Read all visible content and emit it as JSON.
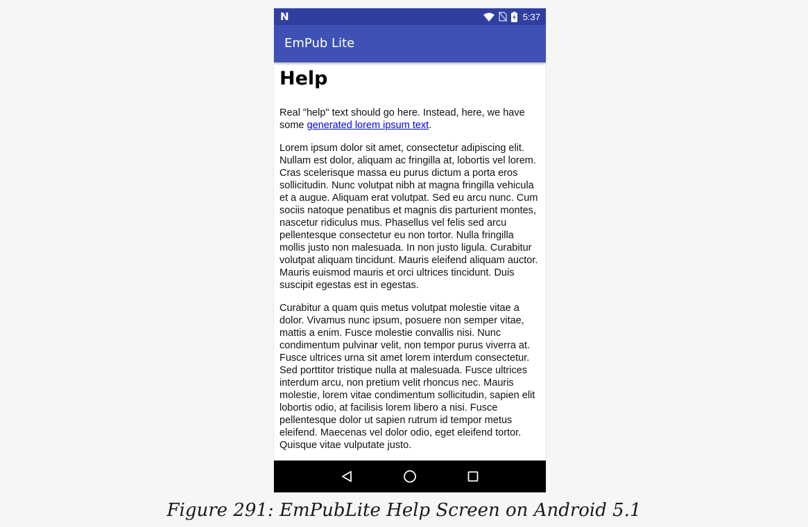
{
  "status_bar": {
    "logo": "N",
    "time": "5:37",
    "icons": [
      "wifi-icon",
      "no-sim-icon",
      "battery-charging-icon"
    ],
    "color": "#303f9f"
  },
  "app_bar": {
    "title": "EmPub Lite",
    "color": "#3f51b5"
  },
  "content": {
    "heading": "Help",
    "intro_before_link": "Real \"help\" text should go here. Instead, here, we have some ",
    "intro_link": "generated lorem ipsum text",
    "intro_after_link": ".",
    "paragraph_1": "Lorem ipsum dolor sit amet, consectetur adipiscing elit. Nullam est dolor, aliquam ac fringilla at, lobortis vel lorem. Cras scelerisque massa eu purus dictum a porta eros sollicitudin. Nunc volutpat nibh at magna fringilla vehicula et a augue. Aliquam erat volutpat. Sed eu arcu nunc. Cum sociis natoque penatibus et magnis dis parturient montes, nascetur ridiculus mus. Phasellus vel felis sed arcu pellentesque consectetur eu non tortor. Nulla fringilla mollis justo non malesuada. In non justo ligula. Curabitur volutpat aliquam tincidunt. Mauris eleifend aliquam auctor. Mauris euismod mauris et orci ultrices tincidunt. Duis suscipit egestas est in egestas.",
    "paragraph_2": "Curabitur a quam quis metus volutpat molestie vitae a dolor. Vivamus nunc ipsum, posuere non semper vitae, mattis a enim. Fusce molestie convallis nisi. Nunc condimentum pulvinar velit, non tempor purus viverra at. Fusce ultrices urna sit amet lorem interdum consectetur. Sed porttitor tristique nulla at malesuada. Fusce ultrices interdum arcu, non pretium velit rhoncus nec. Mauris molestie, lorem vitae condimentum sollicitudin, sapien elit lobortis odio, at facilisis lorem libero a nisi. Fusce pellentesque dolor ut sapien rutrum id tempor metus eleifend. Maecenas vel dolor odio, eget eleifend tortor. Quisque vitae vulputate justo."
  },
  "nav_bar": {
    "buttons": [
      "back-icon",
      "home-icon",
      "recents-icon"
    ]
  },
  "caption": "Figure 291: EmPubLite Help Screen on Android 5.1"
}
